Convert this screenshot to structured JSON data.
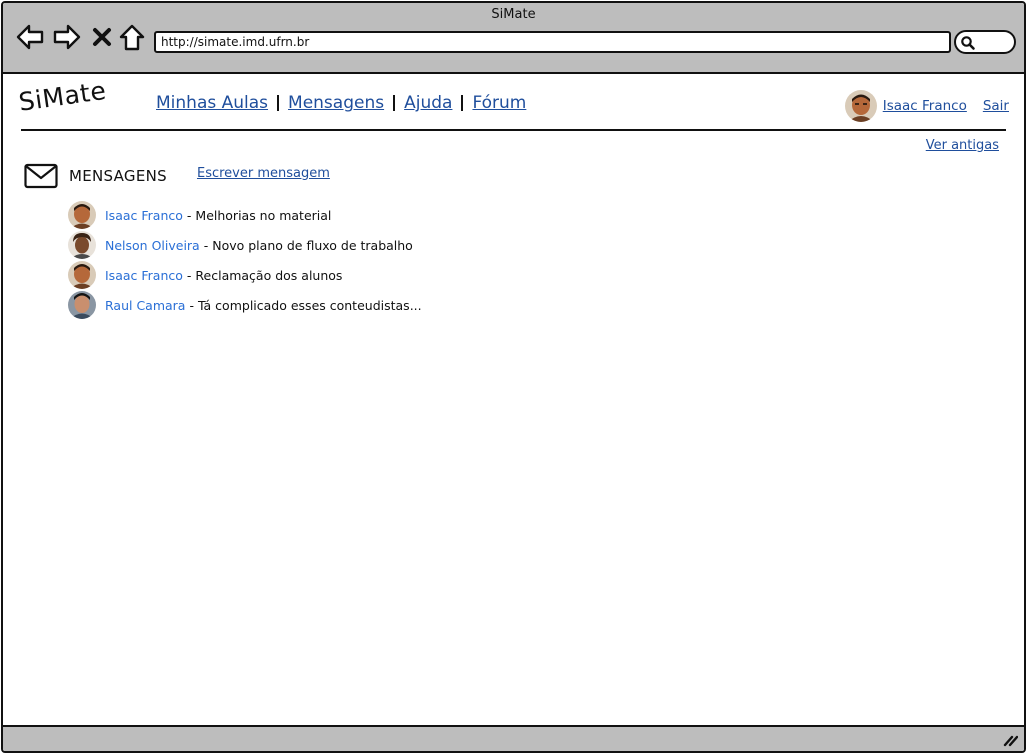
{
  "window": {
    "title": "SiMate",
    "url": "http://simate.imd.ufrn.br"
  },
  "toolbar": {
    "back_icon": "back-arrow-icon",
    "forward_icon": "forward-arrow-icon",
    "stop_icon": "close-x-icon",
    "home_icon": "home-icon",
    "search_icon": "search-icon"
  },
  "header": {
    "logo": "SiMate",
    "nav": [
      {
        "label": "Minhas Aulas"
      },
      {
        "label": "Mensagens"
      },
      {
        "label": "Ajuda"
      },
      {
        "label": "Fórum"
      }
    ],
    "user_name": "Isaac Franco",
    "logout_label": "Sair"
  },
  "messages": {
    "older_link": "Ver antigas",
    "section_title": "MENSAGENS",
    "write_link": "Escrever mensagem",
    "items": [
      {
        "sender": "Isaac Franco",
        "subject": "Melhorias no material",
        "avatar_color": "#b5683a"
      },
      {
        "sender": "Nelson Oliveira",
        "subject": "Novo plano de fluxo de trabalho",
        "avatar_color": "#7a4a2c"
      },
      {
        "sender": "Isaac Franco",
        "subject": "Reclamação dos alunos",
        "avatar_color": "#b5683a"
      },
      {
        "sender": "Raul Camara",
        "subject": "Tá complicado esses conteudistas...",
        "avatar_color": "#3b4b5e"
      }
    ]
  },
  "colors": {
    "link": "#1f4e9c",
    "sender_link": "#2a6fd6",
    "chrome": "#bdbdbd"
  }
}
